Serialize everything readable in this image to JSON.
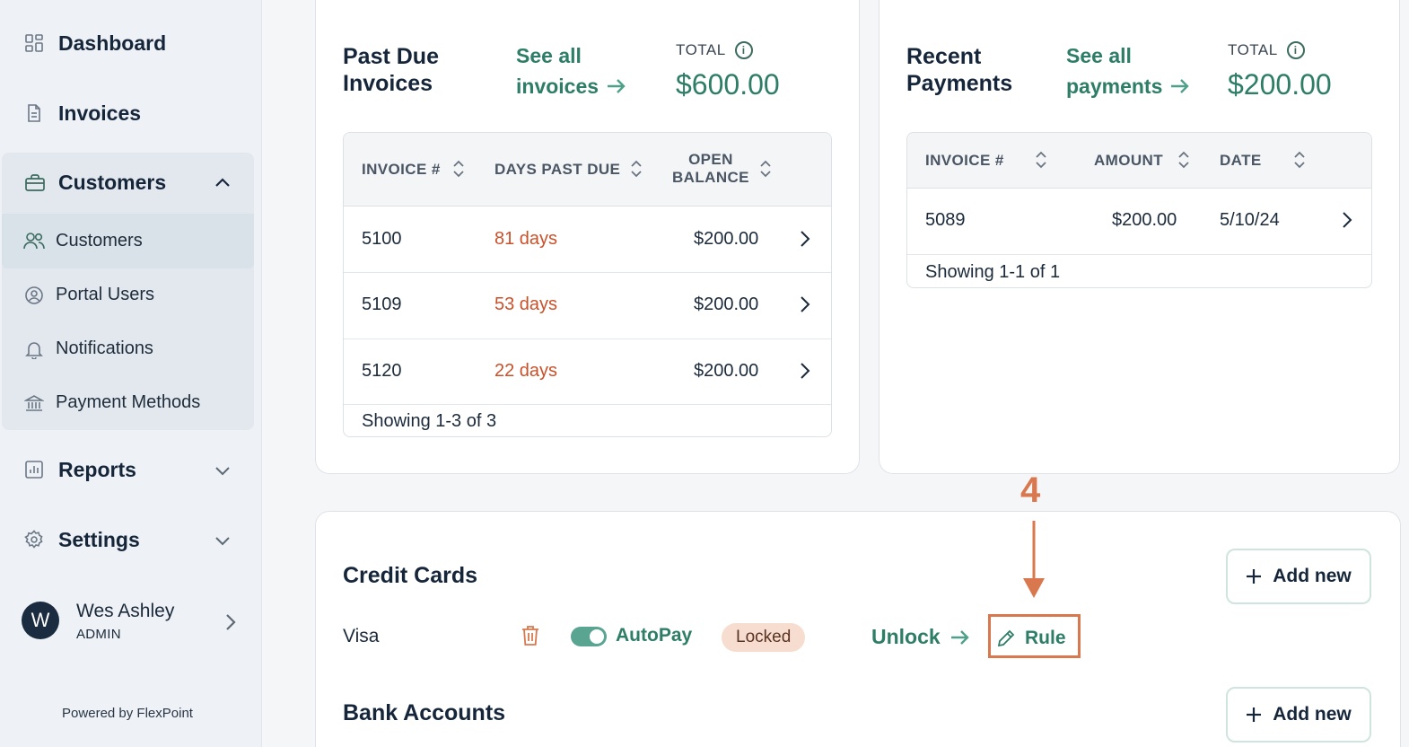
{
  "sidebar": {
    "items": [
      {
        "label": "Dashboard",
        "icon": "dashboard-icon"
      },
      {
        "label": "Invoices",
        "icon": "document-icon"
      },
      {
        "label": "Customers",
        "icon": "briefcase-icon"
      },
      {
        "label": "Reports",
        "icon": "chart-icon"
      },
      {
        "label": "Settings",
        "icon": "gear-icon"
      }
    ],
    "customers_sub": [
      {
        "label": "Customers",
        "icon": "users-icon"
      },
      {
        "label": "Portal Users",
        "icon": "user-circle-icon"
      },
      {
        "label": "Notifications",
        "icon": "bell-icon"
      },
      {
        "label": "Payment Methods",
        "icon": "bank-icon"
      }
    ],
    "user": {
      "initial": "W",
      "name": "Wes Ashley",
      "role": "ADMIN"
    },
    "powered_by": "Powered by FlexPoint"
  },
  "past_due": {
    "title_line1": "Past Due",
    "title_line2": "Invoices",
    "see_all_line1": "See all",
    "see_all_line2": "invoices",
    "total_label": "TOTAL",
    "total_value": "$600.00",
    "columns": {
      "invoice": "INVOICE #",
      "days": "DAYS PAST DUE",
      "open1": "OPEN",
      "open2": "BALANCE"
    },
    "rows": [
      {
        "invoice": "5100",
        "days": "81 days",
        "balance": "$200.00"
      },
      {
        "invoice": "5109",
        "days": "53 days",
        "balance": "$200.00"
      },
      {
        "invoice": "5120",
        "days": "22 days",
        "balance": "$200.00"
      }
    ],
    "showing": "Showing 1-3 of 3"
  },
  "recent_payments": {
    "title_line1": "Recent",
    "title_line2": "Payments",
    "see_all_line1": "See all",
    "see_all_line2": "payments",
    "total_label": "TOTAL",
    "total_value": "$200.00",
    "columns": {
      "invoice": "INVOICE #",
      "amount": "AMOUNT",
      "date": "DATE"
    },
    "rows": [
      {
        "invoice": "5089",
        "amount": "$200.00",
        "date": "5/10/24"
      }
    ],
    "showing": "Showing 1-1 of 1"
  },
  "payment_methods": {
    "credit_title": "Credit Cards",
    "bank_title": "Bank Accounts",
    "add_new": "Add new",
    "card": {
      "name": "Visa",
      "autopay": "AutoPay",
      "status": "Locked",
      "unlock": "Unlock",
      "rule": "Rule",
      "autopay_on": true
    }
  },
  "annotation": {
    "step": "4",
    "color": "#d9784e"
  },
  "colors": {
    "accent": "#2e7d66",
    "due": "#c9512a",
    "annotation": "#d9784e"
  }
}
